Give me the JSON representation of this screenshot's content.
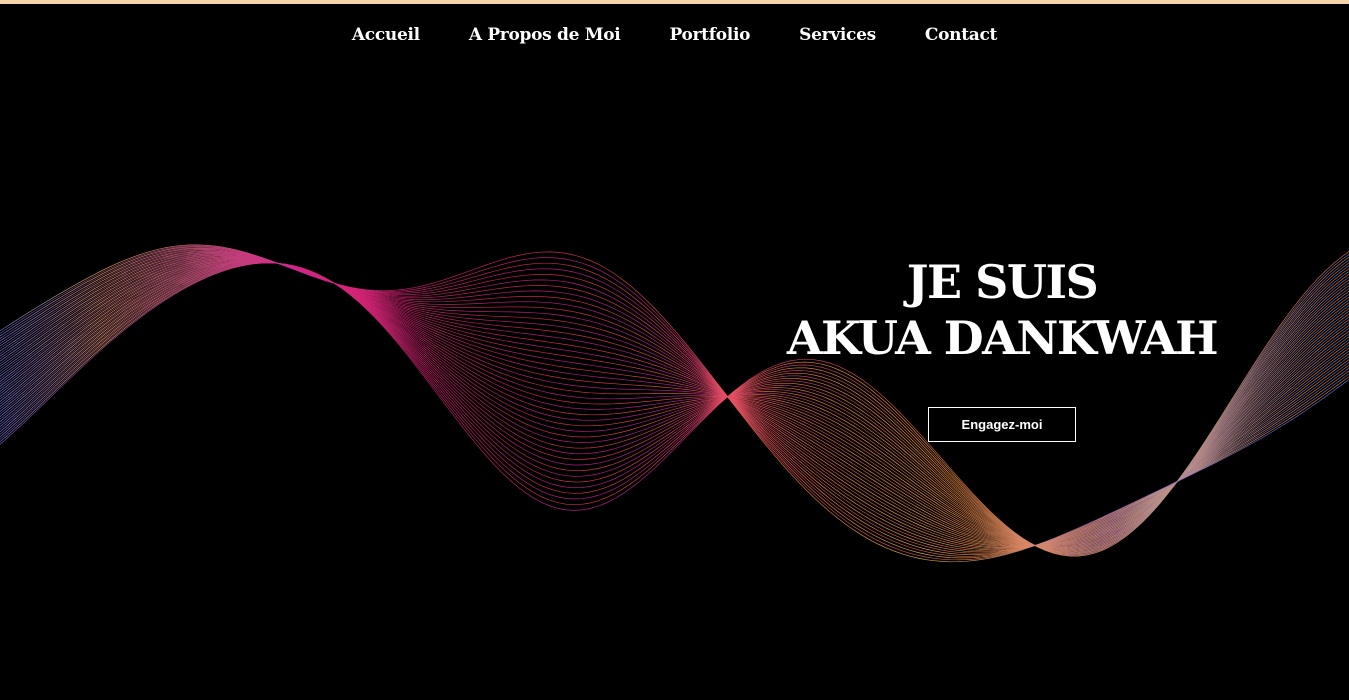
{
  "colors": {
    "background": "#000000",
    "top_strip": "#f6d3a8",
    "text": "#ffffff",
    "wave_palette": [
      "#f0c23a",
      "#ff6a3d",
      "#e0245e",
      "#c2249e",
      "#8a4fd8",
      "#4f8ee8"
    ]
  },
  "nav": {
    "items": [
      {
        "label": "Accueil"
      },
      {
        "label": "A Propos de Moi"
      },
      {
        "label": "Portfolio"
      },
      {
        "label": "Services"
      },
      {
        "label": "Contact"
      }
    ]
  },
  "hero": {
    "line1": "JE SUIS",
    "line2": "AKUA DANKWAH",
    "cta_label": "Engagez-moi"
  }
}
